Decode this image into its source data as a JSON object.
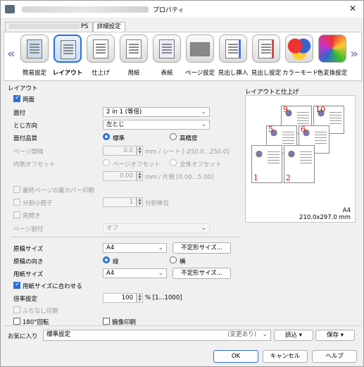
{
  "window": {
    "title": "プロパティ",
    "close": "✕"
  },
  "tabs": [
    "PS",
    "詳細設定"
  ],
  "ribbon": {
    "left_arrow": "«",
    "right_arrow": "»",
    "items": [
      {
        "label": "簡易設定",
        "icon": "quick-setting-icon"
      },
      {
        "label": "レイアウト",
        "icon": "layout-icon"
      },
      {
        "label": "仕上げ",
        "icon": "finishing-icon"
      },
      {
        "label": "用紙",
        "icon": "paper-icon"
      },
      {
        "label": "表紙",
        "icon": "cover-icon"
      },
      {
        "label": "ページ設定",
        "icon": "page-setting-icon"
      },
      {
        "label": "見出し挿入",
        "icon": "tab-insert-icon"
      },
      {
        "label": "見出し設定",
        "icon": "tab-setting-icon"
      },
      {
        "label": "カラーモード",
        "icon": "color-mode-icon"
      },
      {
        "label": "色変換設定",
        "icon": "color-conversion-icon"
      }
    ]
  },
  "layout": {
    "section": "レイアウト",
    "duplex": "両面",
    "pages_per_sheet": {
      "label": "面付",
      "value": "2 in 1 (等倍)"
    },
    "binding": {
      "label": "とじ方向",
      "value": "左とじ"
    },
    "quality": {
      "label": "面付品質",
      "opt1": "標準",
      "opt2": "高精度"
    },
    "page_spacing": {
      "label": "ページ間隔",
      "value": "0.0",
      "unit": "mm / シート [-250.0...250.0]"
    },
    "offset": {
      "label": "内側オフセット",
      "opt1": "ページオフセット",
      "opt2": "全体オフセット",
      "value": "0.00",
      "unit": "mm / 片側 [0.00...5.00]"
    },
    "last_page_back_cover": "最終ページの裏カバー印刷",
    "split_booklet": {
      "label": "分割小冊子",
      "value": "1",
      "unit": "分割単位"
    },
    "booklet": "見開き",
    "page_allocation": {
      "label": "ページ割付",
      "value": "オフ"
    },
    "original_size": {
      "label": "原稿サイズ",
      "value": "A4",
      "button": "不定形サイズ..."
    },
    "orientation": {
      "label": "原稿の向き",
      "opt1": "縦",
      "opt2": "横"
    },
    "paper_size": {
      "label": "用紙サイズ",
      "value": "A4",
      "button": "不定形サイズ..."
    },
    "fit_to_paper": "用紙サイズに合わせる",
    "zoom": {
      "label": "倍率設定",
      "value": "100",
      "unit": "% [1...1000]"
    },
    "borderless": "ふちなし印刷",
    "rotate180": "180°回転",
    "mirror": "鏡像印刷"
  },
  "preview": {
    "title": "レイアウトと仕上げ",
    "paper": "A4",
    "dims": "210.0x297.0 mm",
    "pages": [
      "1",
      "2",
      "5",
      "6",
      "9",
      "10"
    ]
  },
  "favorites": {
    "label": "お気に入り",
    "value": "標準設定",
    "changed": "(変更あり)",
    "load": "読込",
    "save": "保存"
  },
  "buttons": {
    "ok": "OK",
    "cancel": "キャンセル",
    "help": "ヘルプ"
  },
  "colors": {
    "accent": "#2b6fd8",
    "page_number": "#cc0000"
  }
}
